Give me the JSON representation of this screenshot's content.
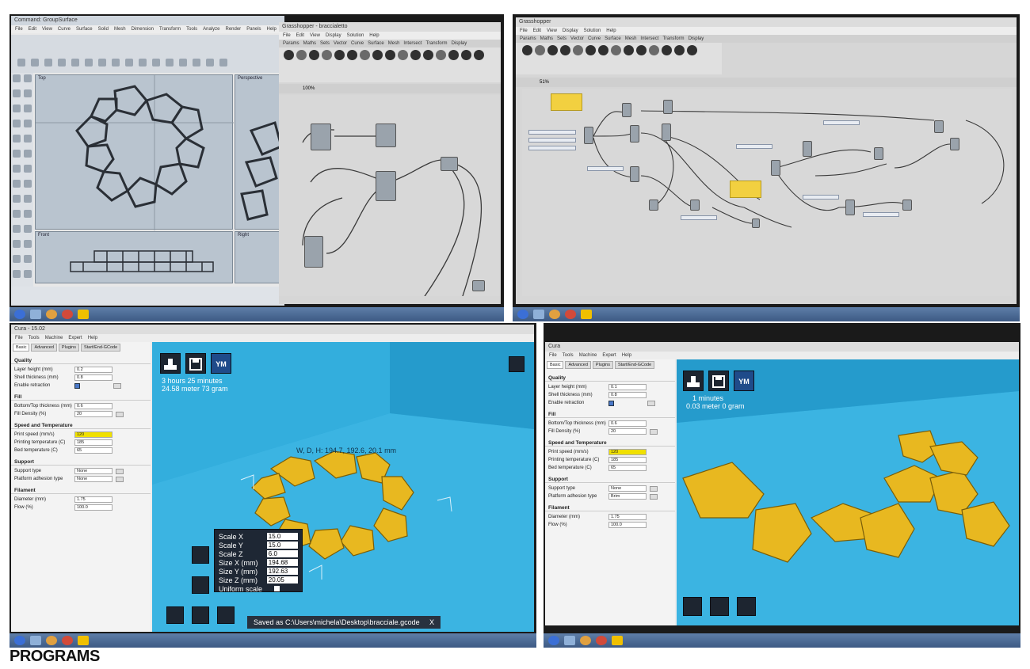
{
  "caption": "PROGRAMS",
  "photos": [
    {
      "name": "rhino-grasshopper-screen",
      "description_labels": {
        "rhino_menu": [
          "File",
          "Edit",
          "View",
          "Curve",
          "Surface",
          "Solid",
          "Mesh",
          "Dimension",
          "Transform",
          "Tools",
          "Analyze",
          "Render",
          "Panels",
          "Help"
        ],
        "viewports": [
          "Top",
          "Perspective",
          "Front",
          "Right"
        ],
        "gh_menu": [
          "File",
          "Edit",
          "View",
          "Display",
          "Solution",
          "Help"
        ],
        "gh_tabs": [
          "Params",
          "Maths",
          "Sets",
          "Vector",
          "Curve",
          "Surface",
          "Mesh",
          "Intersect",
          "Transform",
          "Display"
        ],
        "gh_zoom": "100%"
      }
    },
    {
      "name": "grasshopper-definition-screen",
      "description_labels": {
        "gh_menu": [
          "File",
          "Edit",
          "View",
          "Display",
          "Solution",
          "Help"
        ],
        "gh_tabs": [
          "Params",
          "Maths",
          "Sets",
          "Vector",
          "Curve",
          "Surface",
          "Mesh",
          "Intersect",
          "Transform",
          "Display"
        ],
        "gh_zoom": "51%"
      }
    },
    {
      "name": "cura-bracelet-screen",
      "menu": [
        "File",
        "Tools",
        "Machine",
        "Expert",
        "Help"
      ],
      "tabs": [
        "Basic",
        "Advanced",
        "Plugins",
        "Start/End-GCode"
      ],
      "sections": {
        "quality": "Quality",
        "fill": "Fill",
        "speed": "Speed and Temperature",
        "support": "Support",
        "filament": "Filament"
      },
      "fields": {
        "layer_height": {
          "label": "Layer height (mm)",
          "value": "0.2"
        },
        "shell_thickness": {
          "label": "Shell thickness (mm)",
          "value": "0.8"
        },
        "retraction": {
          "label": "Enable retraction",
          "value": ""
        },
        "bottom_top": {
          "label": "Bottom/Top thickness (mm)",
          "value": "0.6"
        },
        "fill_density": {
          "label": "Fill Density (%)",
          "value": "20"
        },
        "print_speed": {
          "label": "Print speed (mm/s)",
          "value": "120"
        },
        "print_temp": {
          "label": "Printing temperature (C)",
          "value": "185"
        },
        "bed_temp": {
          "label": "Bed temperature (C)",
          "value": "65"
        },
        "support_type": {
          "label": "Support type",
          "value": "None"
        },
        "adhesion": {
          "label": "Platform adhesion type",
          "value": "None"
        },
        "diameter": {
          "label": "Diameter (mm)",
          "value": "1.75"
        },
        "flow": {
          "label": "Flow (%)",
          "value": "100.0"
        }
      },
      "print_time": "3 hours 25 minutes",
      "print_material": "24.58 meter 73 gram",
      "ym_label": "YM",
      "dimensions": "W, D, H: 194.7, 192.6, 20.1 mm",
      "scale_panel": {
        "scale_x": {
          "label": "Scale X",
          "value": "15.0"
        },
        "scale_y": {
          "label": "Scale Y",
          "value": "15.0"
        },
        "scale_z": {
          "label": "Scale Z",
          "value": "6.0"
        },
        "size_x": {
          "label": "Size X (mm)",
          "value": "194.68"
        },
        "size_y": {
          "label": "Size Y (mm)",
          "value": "192.63"
        },
        "size_z": {
          "label": "Size Z (mm)",
          "value": "20.05"
        },
        "uniform": {
          "label": "Uniform scale"
        }
      },
      "saved_message": "Saved as C:\\Users\\michela\\Desktop\\bracciale.gcode",
      "saved_close": "X"
    },
    {
      "name": "cura-necklace-screen",
      "menu": [
        "File",
        "Tools",
        "Machine",
        "Expert",
        "Help"
      ],
      "tabs": [
        "Basic",
        "Advanced",
        "Plugins",
        "Start/End-GCode"
      ],
      "sections": {
        "quality": "Quality",
        "fill": "Fill",
        "speed": "Speed and Temperature",
        "support": "Support",
        "filament": "Filament"
      },
      "fields": {
        "layer_height": {
          "label": "Layer height (mm)",
          "value": "0.1"
        },
        "shell_thickness": {
          "label": "Shell thickness (mm)",
          "value": "0.8"
        },
        "retraction": {
          "label": "Enable retraction",
          "value": ""
        },
        "bottom_top": {
          "label": "Bottom/Top thickness (mm)",
          "value": "0.6"
        },
        "fill_density": {
          "label": "Fill Density (%)",
          "value": "20"
        },
        "print_speed": {
          "label": "Print speed (mm/s)",
          "value": "120"
        },
        "print_temp": {
          "label": "Printing temperature (C)",
          "value": "185"
        },
        "bed_temp": {
          "label": "Bed temperature (C)",
          "value": "65"
        },
        "support_type": {
          "label": "Support type",
          "value": "None"
        },
        "adhesion": {
          "label": "Platform adhesion type",
          "value": "Brim"
        },
        "diameter": {
          "label": "Diameter (mm)",
          "value": "1.75"
        },
        "flow": {
          "label": "Flow (%)",
          "value": "100.0"
        }
      },
      "print_time": "1 minutes",
      "print_material": "0.03 meter 0 gram",
      "ym_label": "YM"
    }
  ],
  "colors": {
    "cura_blue": "#2da6d8",
    "model_yellow": "#f0c020",
    "gh_canvas": "#d8d8d8",
    "rhino_viewport": "#b9c4cf"
  }
}
